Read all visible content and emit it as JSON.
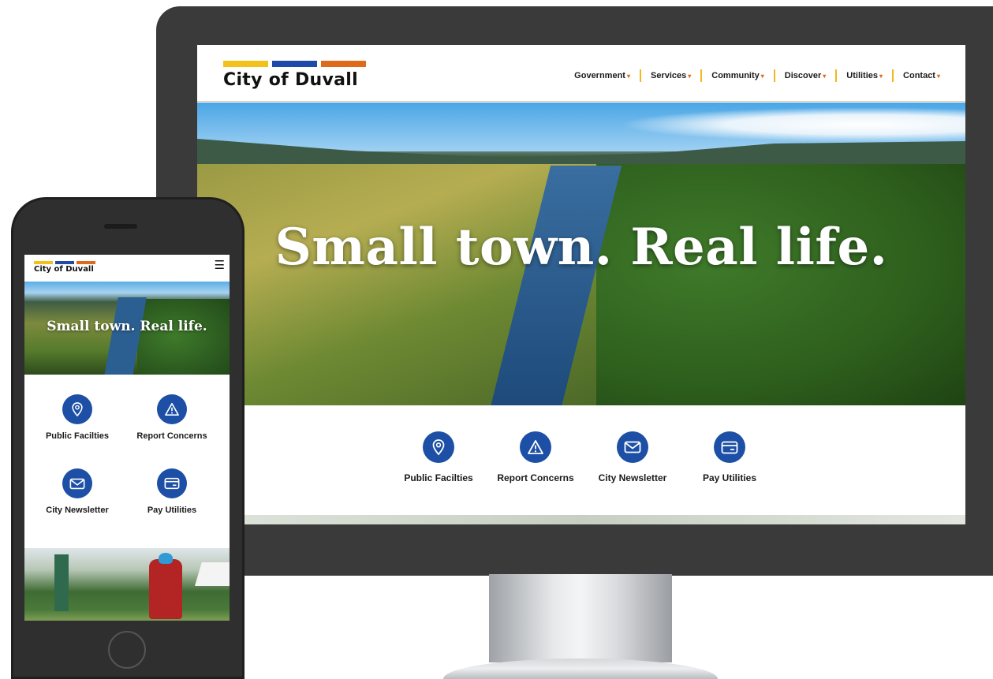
{
  "site": {
    "name": "City of Duvall",
    "brand_colors": {
      "yellow": "#f2c21b",
      "blue": "#1f4aa8",
      "orange": "#e06a1b",
      "icon_blue": "#1c4fa5"
    }
  },
  "desktop": {
    "nav": [
      {
        "label": "Government"
      },
      {
        "label": "Services"
      },
      {
        "label": "Community"
      },
      {
        "label": "Discover"
      },
      {
        "label": "Utilities"
      },
      {
        "label": "Contact"
      }
    ],
    "nav_caret": "▾",
    "hero_title": "Small town. Real life.",
    "quick_links": [
      {
        "label": "Public Facilties",
        "icon": "map-pin-icon"
      },
      {
        "label": "Report Concerns",
        "icon": "warning-icon"
      },
      {
        "label": "City Newsletter",
        "icon": "envelope-icon"
      },
      {
        "label": "Pay Utilities",
        "icon": "credit-card-icon"
      }
    ]
  },
  "mobile": {
    "menu_glyph": "☰",
    "hero_title": "Small town. Real life.",
    "quick_links": [
      {
        "label": "Public Facilties",
        "icon": "map-pin-icon"
      },
      {
        "label": "Report Concerns",
        "icon": "warning-icon"
      },
      {
        "label": "City Newsletter",
        "icon": "envelope-icon"
      },
      {
        "label": "Pay Utilities",
        "icon": "credit-card-icon"
      }
    ]
  }
}
